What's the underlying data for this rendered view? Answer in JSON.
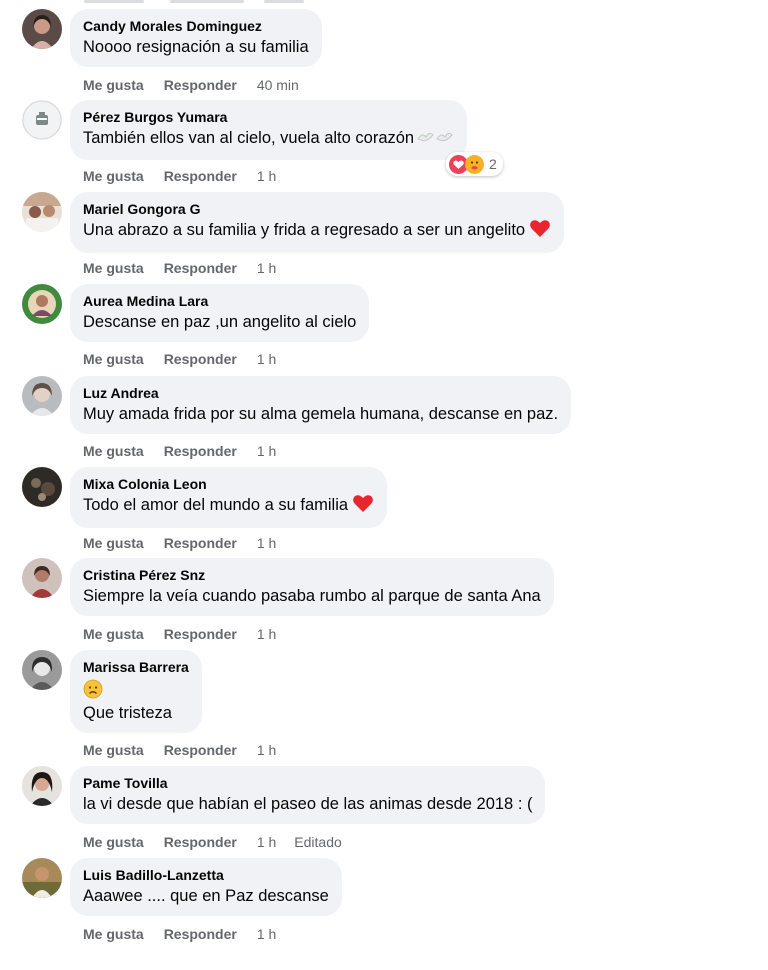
{
  "ui": {
    "like_label": "Me gusta",
    "reply_label": "Responder"
  },
  "comments": [
    {
      "author": "Candy Morales Dominguez",
      "text": "Noooo resignación a su familia",
      "time": "40 min",
      "avatar": "woman-portrait"
    },
    {
      "author": "Pérez Burgos Yumara",
      "text": "También ellos van al cielo, vuela alto corazón",
      "time": "1 h",
      "avatar": "logo-badge",
      "reactions": {
        "types": [
          "love",
          "care"
        ],
        "count": "2"
      },
      "emoji": "doves"
    },
    {
      "author": "Mariel Gongora G",
      "text": "Una abrazo a su familia y frida a regresado a ser un angelito",
      "time": "1 h",
      "avatar": "group-photo",
      "emoji": "red-heart"
    },
    {
      "author": "Aurea Medina Lara",
      "text": "Descanse en paz ,un angelito al cielo",
      "time": "1 h",
      "avatar": "woman-green-frame"
    },
    {
      "author": "Luz Andrea",
      "text": "Muy amada frida por su alma gemela humana, descanse en paz.",
      "time": "1 h",
      "avatar": "woman-gray"
    },
    {
      "author": "Mixa Colonia Leon",
      "text": "Todo el amor del mundo a su familia",
      "time": "1 h",
      "avatar": "dark-photo",
      "emoji": "red-heart"
    },
    {
      "author": "Cristina Pérez Snz",
      "text": "Siempre la veía cuando pasaba rumbo al parque de santa Ana",
      "time": "1 h",
      "avatar": "woman-reddish"
    },
    {
      "author": "Marissa Barrera",
      "text_lines": [
        "Que tristeza"
      ],
      "time": "1 h",
      "avatar": "woman-bw",
      "emoji": "sad-face"
    },
    {
      "author": "Pame Tovilla",
      "text": "la vi desde que habían el paseo de las animas desde 2018 : (",
      "time": "1 h",
      "edited": "Editado",
      "avatar": "woman-dark-hair"
    },
    {
      "author": "Luis Badillo-Lanzetta",
      "text": "Aaawee .... que en Paz descanse",
      "time": "1 h",
      "avatar": "man-outdoor"
    }
  ]
}
